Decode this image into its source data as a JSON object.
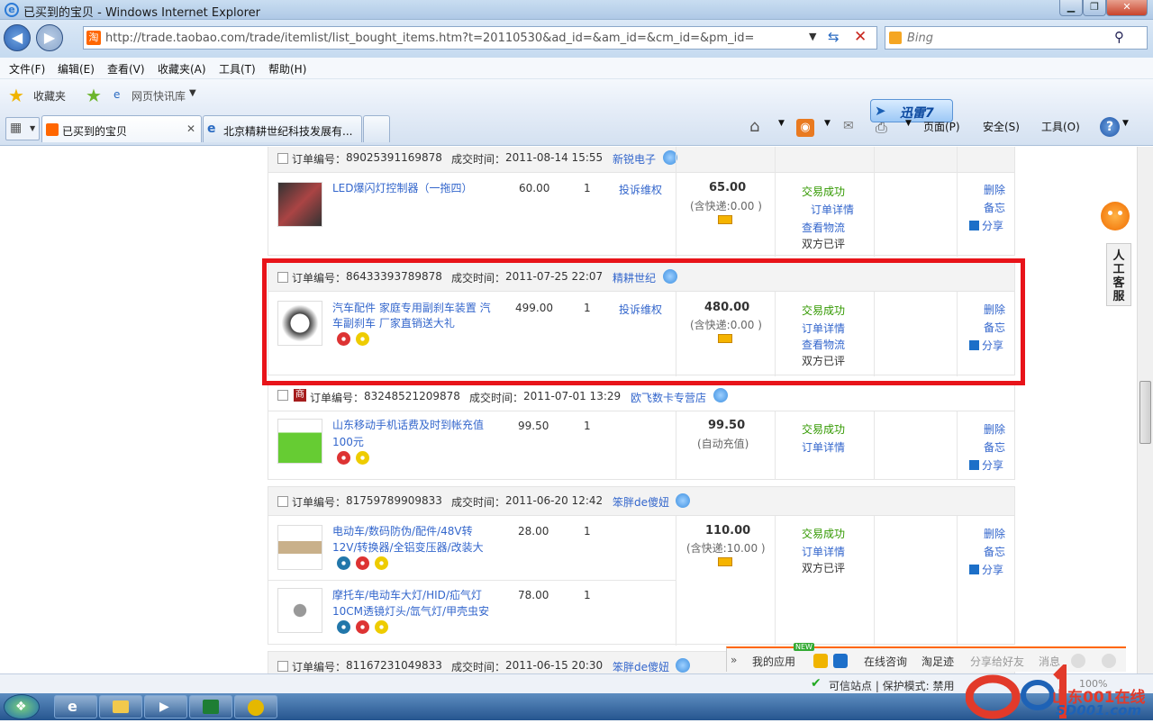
{
  "window": {
    "title": "已买到的宝贝 - Windows Internet Explorer"
  },
  "address": {
    "url": "http://trade.taobao.com/trade/itemlist/list_bought_items.htm?t=20110530&ad_id=&am_id=&cm_id=&pm_id=",
    "search_placeholder": "Bing"
  },
  "menu": [
    "文件(F)",
    "编辑(E)",
    "查看(V)",
    "收藏夹(A)",
    "工具(T)",
    "帮助(H)"
  ],
  "favbar": {
    "favorites": "收藏夹",
    "quick": "网页快讯库"
  },
  "tabs": [
    {
      "label": "已买到的宝贝"
    },
    {
      "label": "北京精耕世纪科技发展有..."
    }
  ],
  "toolbar": {
    "xunlei": "迅雷7",
    "page": "页面(P)",
    "safety": "安全(S)",
    "tools": "工具(O)"
  },
  "labels": {
    "order_no": "订单编号：",
    "deal_time": "成交时间：",
    "complain": "投诉维权",
    "success": "交易成功",
    "detail": "订单详情",
    "logistics": "查看物流",
    "rated": "双方已评",
    "delete": "删除",
    "memo": "备忘",
    "share": "分享",
    "shop_badge": "商"
  },
  "orders": [
    {
      "no": "89025391169878",
      "time": "2011-08-14 15:55",
      "seller": "新锐电子",
      "items": [
        {
          "title1": "LED爆闪灯控制器（一拖四）",
          "title2": "",
          "price": "60.00",
          "qty": "1"
        }
      ],
      "total": "65.00",
      "postage": "(含快递:0.00 )"
    },
    {
      "no": "86433393789878",
      "time": "2011-07-25 22:07",
      "seller": "精耕世纪",
      "items": [
        {
          "title1": "汽车配件 家庭专用副刹车装置 汽",
          "title2": "车副刹车 厂家直销送大礼",
          "price": "499.00",
          "qty": "1"
        }
      ],
      "total": "480.00",
      "postage": "(含快递:0.00 )"
    },
    {
      "no": "83248521209878",
      "time": "2011-07-01 13:29",
      "seller": "欧飞数卡专营店",
      "items": [
        {
          "title1": "山东移动手机话费及时到帐充值",
          "title2": "100元",
          "price": "99.50",
          "qty": "1"
        }
      ],
      "total": "99.50",
      "postage": "(自动充值)"
    },
    {
      "no": "81759789909833",
      "time": "2011-06-20 12:42",
      "seller": "笨胖de傻妞",
      "items": [
        {
          "title1": "电动车/数码防伪/配件/48V转",
          "title2": "12V/转换器/全铝变压器/改装大",
          "price": "28.00",
          "qty": "1"
        },
        {
          "title1": "摩托车/电动车大灯/HID/疝气灯",
          "title2": "10CM透镜灯头/氙气灯/甲壳虫安",
          "price": "78.00",
          "qty": "1"
        }
      ],
      "total": "110.00",
      "postage": "(含快递:10.00 )"
    },
    {
      "no": "81167231049833",
      "time": "2011-06-15 20:30",
      "seller": "笨胖de傻妞",
      "items": [],
      "total": "",
      "postage": ""
    }
  ],
  "side": {
    "kefu": "人工客服"
  },
  "appbar": {
    "myapps": "我的应用",
    "new": "NEW",
    "online": "在线咨询",
    "footprint": "淘足迹",
    "share": "分享给好友",
    "msg": "消息"
  },
  "status": {
    "zone": "可信站点 | 保护模式: 禁用",
    "zoom": "100%"
  },
  "watermark": {
    "site": "山东001在线",
    "domain": "SD001.com"
  }
}
